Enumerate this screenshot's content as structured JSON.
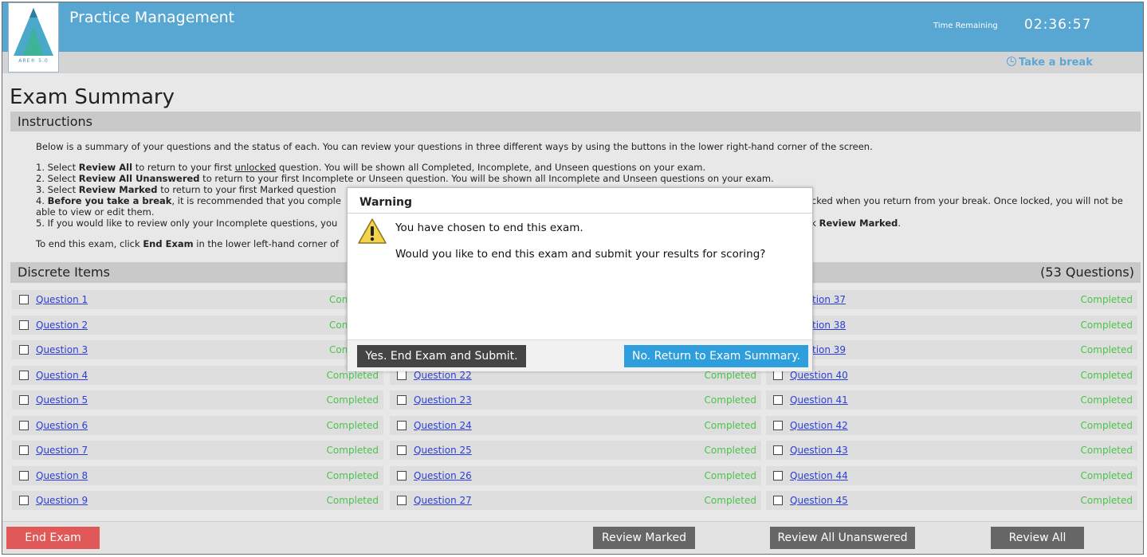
{
  "header": {
    "app_title": "Practice Management",
    "logo_text": "ARE® 5.0",
    "time_remaining_label": "Time Remaining",
    "time_remaining_value": "02:36:57",
    "take_break_label": "Take a break"
  },
  "page_title": "Exam Summary",
  "instructions": {
    "title": "Instructions",
    "intro": "Below is a summary of your questions and the status of each. You can review your questions in three different ways by using the buttons in the lower right-hand corner of the screen.",
    "line1": {
      "a": "1. Select ",
      "b": "Review All",
      "c": " to return to your first ",
      "d": "unlocked",
      "e": " question. You will be shown all Completed, Incomplete, and Unseen questions on your exam."
    },
    "line2": {
      "a": "2. Select ",
      "b": "Review All Unanswered",
      "c": " to return to your first Incomplete or Unseen question. You will be shown all Incomplete and Unseen questions on your exam."
    },
    "line3": {
      "a": "3. Select ",
      "b": "Review Marked",
      "c": " to return to your first Marked question"
    },
    "line4": {
      "a": "4. ",
      "b": "Before you take a break",
      "c": ", it is recommended that you comple",
      "d": "cked when you return from your break. Once locked, you will not be able to view or edit them."
    },
    "line5": {
      "a": "5. If you would like to review only your Incomplete questions, you",
      "b": "k ",
      "c": "Review Marked",
      "d": "."
    },
    "end_line": {
      "a": "To end this exam, click ",
      "b": "End Exam",
      "c": " in the lower left-hand corner of"
    }
  },
  "discrete": {
    "title": "Discrete Items",
    "count": "(53 Questions)"
  },
  "question_columns": [
    [
      {
        "label": "Question 1",
        "status": "Con"
      },
      {
        "label": "Question 2",
        "status": "Con"
      },
      {
        "label": "Question 3",
        "status": "Con"
      },
      {
        "label": "Question 4",
        "status": "Completed"
      },
      {
        "label": "Question 5",
        "status": "Completed"
      },
      {
        "label": "Question 6",
        "status": "Completed"
      },
      {
        "label": "Question 7",
        "status": "Completed"
      },
      {
        "label": "Question 8",
        "status": "Completed"
      },
      {
        "label": "Question 9",
        "status": "Completed"
      }
    ],
    [
      {
        "label": "",
        "status": ""
      },
      {
        "label": "",
        "status": ""
      },
      {
        "label": "",
        "status": ""
      },
      {
        "label": "Question 22",
        "status": "Completed"
      },
      {
        "label": "Question 23",
        "status": "Completed"
      },
      {
        "label": "Question 24",
        "status": "Completed"
      },
      {
        "label": "Question 25",
        "status": "Completed"
      },
      {
        "label": "Question 26",
        "status": "Completed"
      },
      {
        "label": "Question 27",
        "status": "Completed"
      }
    ],
    [
      {
        "label": "tion 37",
        "status": "Completed"
      },
      {
        "label": "tion 38",
        "status": "Completed"
      },
      {
        "label": "tion 39",
        "status": "Completed"
      },
      {
        "label": "Question 40",
        "status": "Completed"
      },
      {
        "label": "Question 41",
        "status": "Completed"
      },
      {
        "label": "Question 42",
        "status": "Completed"
      },
      {
        "label": "Question 43",
        "status": "Completed"
      },
      {
        "label": "Question 44",
        "status": "Completed"
      },
      {
        "label": "Question 45",
        "status": "Completed"
      }
    ]
  ],
  "footer": {
    "end_exam": "End Exam",
    "review_marked": "Review Marked",
    "review_unanswered": "Review All Unanswered",
    "review_all": "Review All"
  },
  "modal": {
    "title": "Warning",
    "message1": "You have chosen to end this exam.",
    "message2": "Would you like to end this exam and submit your results for scoring?",
    "yes_label": "Yes. End Exam and Submit.",
    "no_label": "No. Return to Exam Summary."
  },
  "colors": {
    "header_blue": "#58a6d2",
    "completed_green": "#4cc24c",
    "link_blue": "#2b3fd6",
    "end_exam_red": "#e05858",
    "primary_blue": "#2e9fdc"
  }
}
